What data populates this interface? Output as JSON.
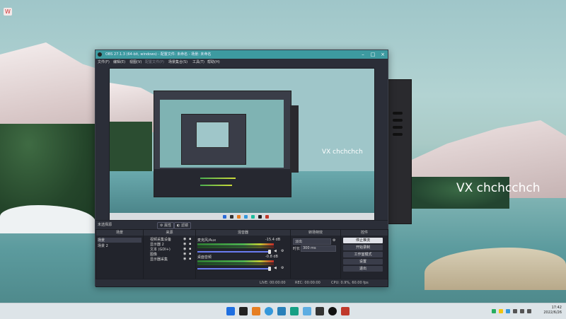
{
  "desktop": {
    "watermark": "VX chchcchch",
    "preview_watermark": "VX chchchch",
    "top_left_icon": "W"
  },
  "window": {
    "title": "OBS 27.1.3 (64-bit, windows) - 配置文件: 未命名 - 场景: 未命名",
    "menu": [
      "文件(F)",
      "编辑(E)",
      "视图(V)",
      "配置文件(P)",
      "场景集合(S)",
      "工具(T)",
      "帮助(H)"
    ],
    "menu_disabled_index": 3
  },
  "scenebar": {
    "label": "未选择源",
    "properties": "属性",
    "filters": "滤镜"
  },
  "scenes": {
    "header": "场景",
    "items": [
      "场景",
      "场景 2"
    ]
  },
  "sources": {
    "header": "来源",
    "items": [
      "视频采集设备",
      "显示器 2",
      "文本 (GDI+)",
      "图像",
      "显示器采集"
    ]
  },
  "mixer": {
    "header": "混音器",
    "channels": [
      {
        "name": "麦克风/Aux",
        "db": "-15.4 dB"
      },
      {
        "name": "桌面音频",
        "db": "-0.8 dB"
      }
    ]
  },
  "transitions": {
    "header": "转场特效",
    "type": "淡出",
    "duration_label": "时长",
    "duration_value": "300 ms"
  },
  "controls": {
    "header": "控件",
    "buttons": [
      "停止推流",
      "开始录制",
      "工作室模式",
      "设置",
      "退出"
    ]
  },
  "status": {
    "live": "LIVE: 00:00:00",
    "rec": "REC: 00:00:00",
    "cpu": "CPU: 0.9%, 60.00 fps"
  },
  "taskbar": {
    "time": "17:42",
    "date": "2022/6/26",
    "icons": [
      "windows-icon",
      "g-app-icon",
      "orange-app-icon",
      "blue-app-icon",
      "s-app-icon",
      "green-app-icon",
      "cloud-icon",
      "terminal-icon",
      "obs-icon",
      "red-app-icon"
    ]
  },
  "colors": {
    "accent": "#3d9aa0",
    "obs_bg": "#2b2e38",
    "dock_bg": "#22242c"
  }
}
